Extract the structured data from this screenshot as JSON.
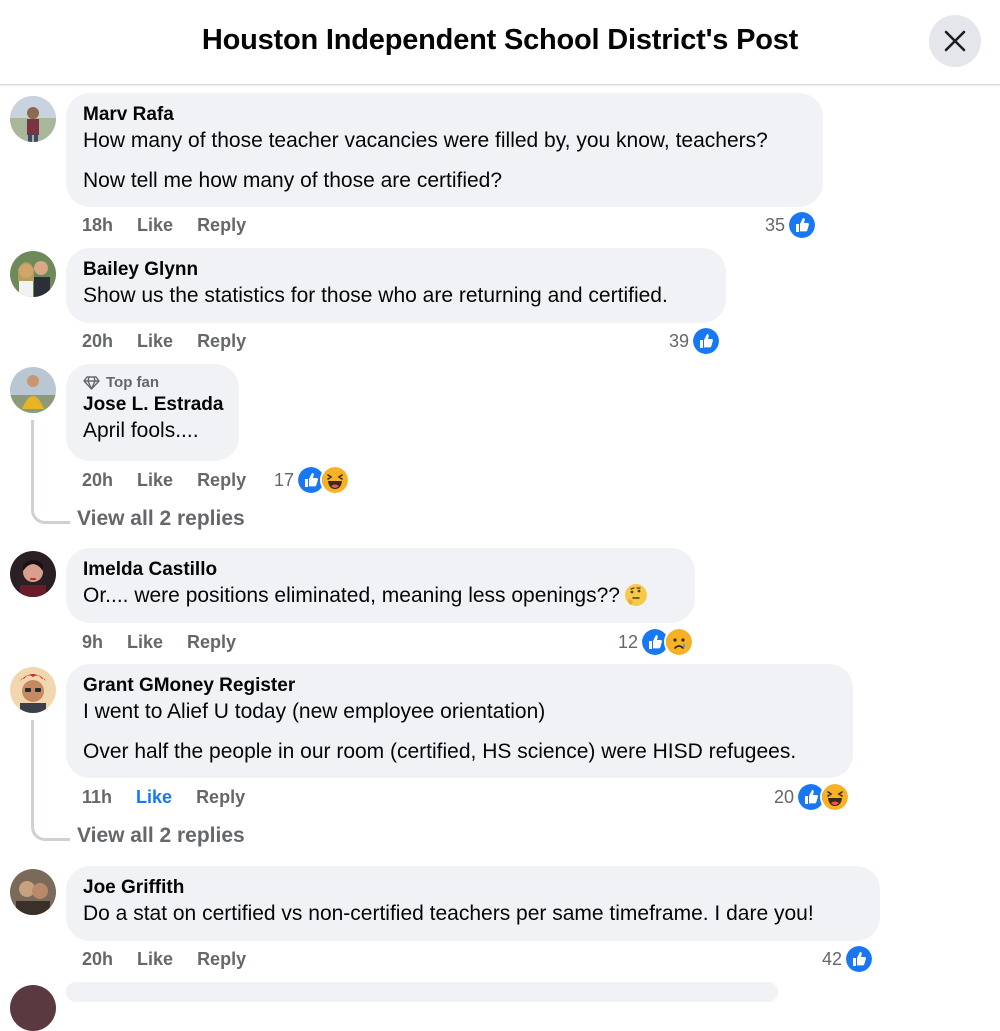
{
  "header": {
    "title": "Houston Independent School District's Post"
  },
  "comments": [
    {
      "name": "Marv Rafa",
      "lines": [
        "How many of those teacher vacancies were filled by, you know, teachers?",
        "Now tell me how many of those are certified?"
      ],
      "time": "18h",
      "like": "Like",
      "reply": "Reply",
      "reaction_count": "35"
    },
    {
      "name": "Bailey Glynn",
      "lines": [
        "Show us the statistics for those who are returning and certified."
      ],
      "time": "20h",
      "like": "Like",
      "reply": "Reply",
      "reaction_count": "39"
    },
    {
      "badge": "Top fan",
      "name": "Jose L. Estrada",
      "lines": [
        "April fools...."
      ],
      "time": "20h",
      "like": "Like",
      "reply": "Reply",
      "reaction_count": "17",
      "view_replies": "View all 2 replies"
    },
    {
      "name": "Imelda Castillo",
      "lines": [
        "Or.... were positions eliminated, meaning less openings??"
      ],
      "time": "9h",
      "like": "Like",
      "reply": "Reply",
      "reaction_count": "12"
    },
    {
      "name": "Grant GMoney Register",
      "lines": [
        "I went to Alief U today (new employee orientation)",
        "Over half the people in our room (certified, HS science) were HISD refugees."
      ],
      "time": "11h",
      "like": "Like",
      "reply": "Reply",
      "reaction_count": "20",
      "view_replies": "View all 2 replies"
    },
    {
      "name": "Joe Griffith",
      "lines": [
        "Do a stat on certified vs non-certified teachers per same timeframe. I dare you!"
      ],
      "time": "20h",
      "like": "Like",
      "reply": "Reply",
      "reaction_count": "42"
    }
  ],
  "colors": {
    "like_blue": "#1877f2",
    "bubble": "#f0f2f5",
    "meta_gray": "#65676b"
  }
}
